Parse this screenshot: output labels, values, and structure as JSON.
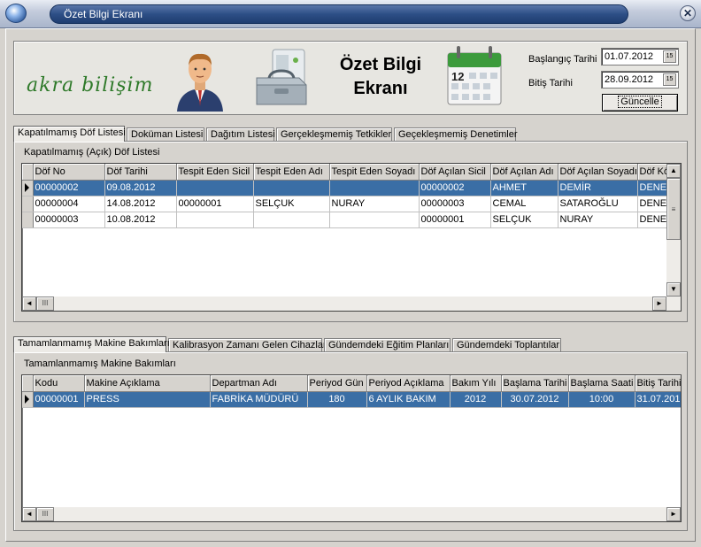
{
  "window": {
    "title": "Özet Bilgi Ekranı",
    "close_glyph": "✕"
  },
  "header": {
    "logo_text": "akra bilişim",
    "title_line1": "Özet Bilgi",
    "title_line2": "Ekranı",
    "calendar_day": "12",
    "start_label": "Başlangıç Tarihi",
    "start_value": "01.07.2012",
    "end_label": "Bitiş Tarihi",
    "end_value": "28.09.2012",
    "date_button_glyph": "15",
    "update_button": "Güncelle"
  },
  "top_tabs": [
    "Kapatılmamış Döf Listesi",
    "Doküman Listesi",
    "Dağıtım Listesi",
    "Gerçekleşmemiş Tetkikler",
    "Geçekleşmemiş Denetimler"
  ],
  "dof_panel": {
    "caption": "Kapatılmamış (Açık) Döf Listesi",
    "columns": [
      "Döf No",
      "Döf Tarihi",
      "Tespit Eden Sicil",
      "Tespit Eden Adı",
      "Tespit Eden Soyadı",
      "Döf Açılan Sicil",
      "Döf Açılan Adı",
      "Döf Açılan Soyadı",
      "Döf Kö"
    ],
    "rows": [
      [
        "00000002",
        "09.08.2012",
        "",
        "",
        "",
        "00000002",
        "AHMET",
        "DEMİR",
        "DENE"
      ],
      [
        "00000004",
        "14.08.2012",
        "00000001",
        "SELÇUK",
        "NURAY",
        "00000003",
        "CEMAL",
        "SATAROĞLU",
        "DENE"
      ],
      [
        "00000003",
        "10.08.2012",
        "",
        "",
        "",
        "00000001",
        "SELÇUK",
        "NURAY",
        "DENE"
      ]
    ]
  },
  "bottom_tabs": [
    "Tamamlanmamış Makine Bakımları",
    "Kalibrasyon Zamanı Gelen Cihazlar",
    "Gündemdeki Eğitim Planları",
    "Gündemdeki Toplantılar"
  ],
  "maint_panel": {
    "caption": "Tamamlanmamış Makine Bakımları",
    "columns": [
      "Kodu",
      "Makine Açıklama",
      "Departman Adı",
      "Periyod Gün",
      "Periyod Açıklama",
      "Bakım Yılı",
      "Başlama Tarihi",
      "Başlama Saati",
      "Bitiş Tarihi"
    ],
    "rows": [
      [
        "00000001",
        "PRESS",
        "FABRİKA MÜDÜRÜ",
        "180",
        "6 AYLIK BAKIM",
        "2012",
        "30.07.2012",
        "10:00",
        "31.07.201"
      ]
    ]
  },
  "scroll_glyphs": {
    "up": "▲",
    "down": "▼",
    "left": "◄",
    "right": "►",
    "grip": "III"
  },
  "colors": {
    "selection": "#3a6ea5",
    "title_bar": "#2d4f86",
    "window_bg": "#d6d3ce"
  }
}
